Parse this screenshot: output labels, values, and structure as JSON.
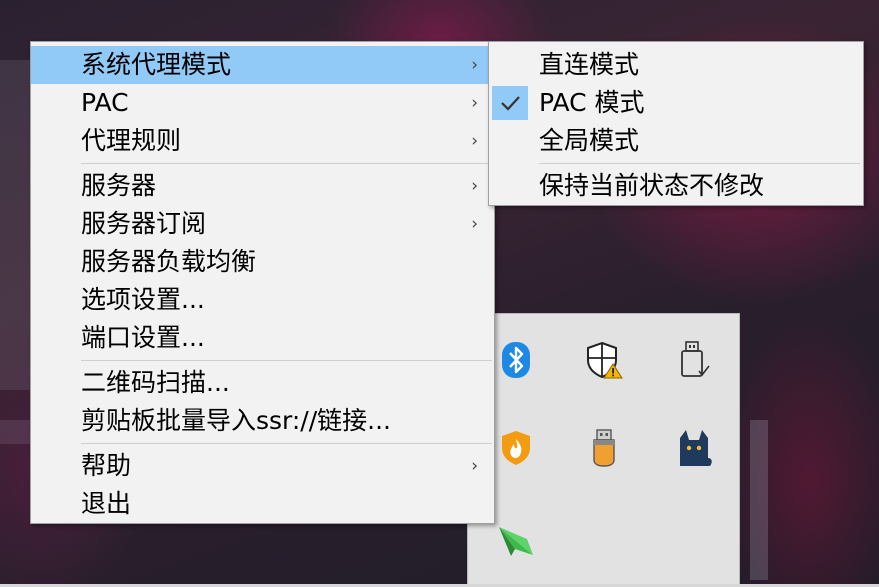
{
  "main_menu": {
    "items": [
      {
        "label": "系统代理模式",
        "submenu": true,
        "active": true
      },
      {
        "label": "PAC",
        "submenu": true
      },
      {
        "label": "代理规则",
        "submenu": true
      },
      {
        "label": "服务器",
        "submenu": true
      },
      {
        "label": "服务器订阅",
        "submenu": true
      },
      {
        "label": "服务器负载均衡",
        "submenu": false
      },
      {
        "label": "选项设置...",
        "submenu": false
      },
      {
        "label": "端口设置...",
        "submenu": false
      },
      {
        "label": "二维码扫描...",
        "submenu": false
      },
      {
        "label": "剪贴板批量导入ssr://链接...",
        "submenu": false
      },
      {
        "label": "帮助",
        "submenu": true
      },
      {
        "label": "退出",
        "submenu": false
      }
    ],
    "arrow_glyph": "›"
  },
  "proxy_mode_submenu": {
    "items": [
      {
        "label": "直连模式",
        "checked": false
      },
      {
        "label": "PAC 模式",
        "checked": true
      },
      {
        "label": "全局模式",
        "checked": false
      },
      {
        "label": "保持当前状态不修改",
        "checked": false
      }
    ]
  },
  "tray_icons": [
    {
      "name": "bluetooth-icon",
      "color": "#1e88e5"
    },
    {
      "name": "windows-security-warning-icon",
      "color": "#f5b400"
    },
    {
      "name": "usb-drive-icon",
      "color": "#333333"
    },
    {
      "name": "shield-flame-icon",
      "color": "#f39c12"
    },
    {
      "name": "usb-stick-icon",
      "color": "#f0a030"
    },
    {
      "name": "cat-icon",
      "color": "#1f3a5c"
    },
    {
      "name": "paper-plane-icon",
      "color": "#3dbb4a"
    }
  ],
  "colors": {
    "menu_bg": "#f2f2f2",
    "highlight": "#91c9f7",
    "separator": "#cfcfcf"
  }
}
